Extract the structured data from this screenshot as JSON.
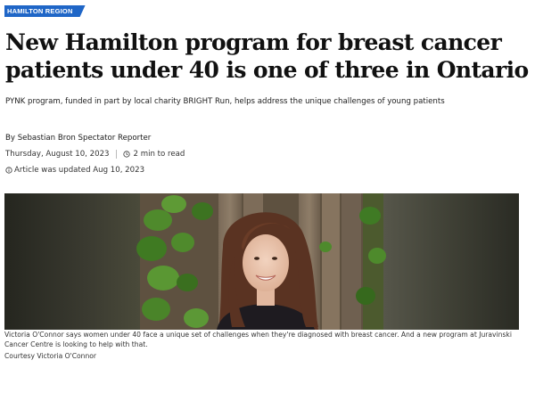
{
  "region_tag": "HAMILTON REGION",
  "headline": "New Hamilton program for breast cancer patients under 40 is one of three in Ontario",
  "subheadline": "PYNK program, funded in part by local charity BRIGHT Run, helps address the unique challenges of young patients",
  "byline": {
    "prefix": "By",
    "author": "Sebastian Bron",
    "role": "Spectator Reporter"
  },
  "meta": {
    "date": "Thursday, August 10, 2023",
    "read_time": "2 min to read",
    "updated": "Article was updated Aug 10, 2023"
  },
  "icons": {
    "clock": "clock-icon",
    "info": "info-icon"
  },
  "photo": {
    "caption": "Victoria O'Connor says women under 40 face a unique set of challenges when they're diagnosed with breast cancer. And a new program at Juravinski Cancer Centre is looking to help with that.",
    "credit": "Courtesy Victoria O'Connor"
  },
  "colors": {
    "tag_background": "#1f66c7",
    "tag_text": "#ffffff"
  }
}
